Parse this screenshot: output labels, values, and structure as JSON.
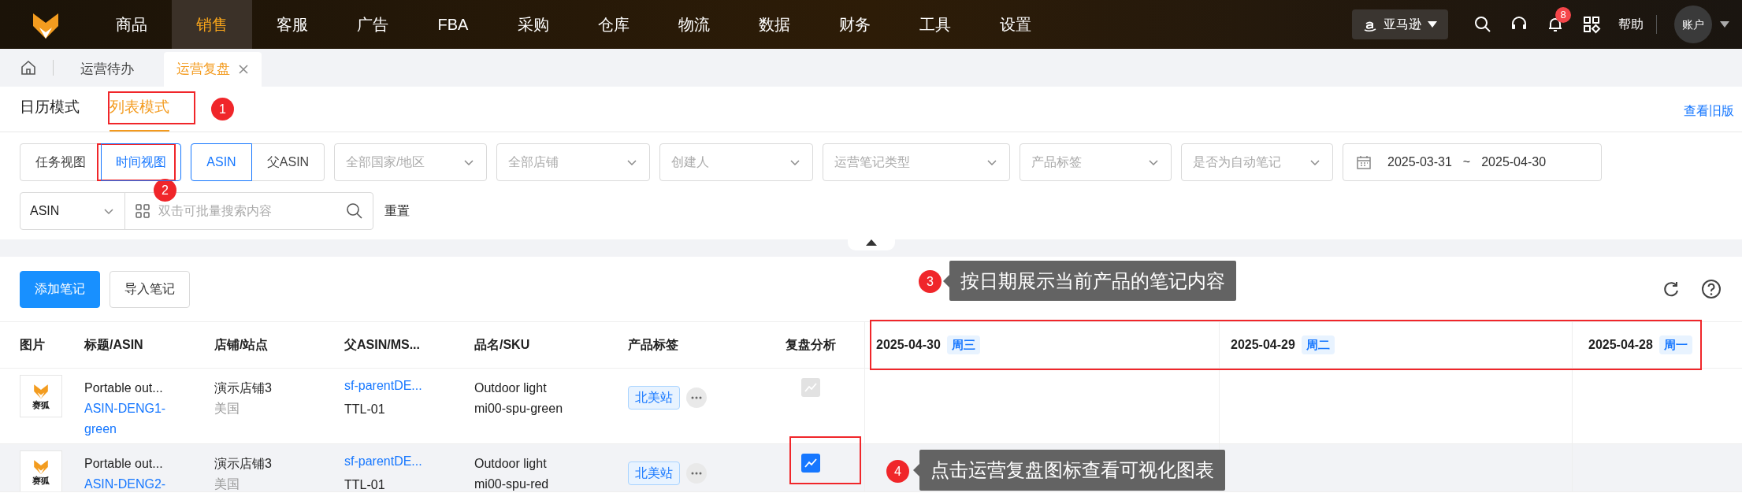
{
  "nav": {
    "items": [
      {
        "label": "商品",
        "selected": false
      },
      {
        "label": "销售",
        "selected": true
      },
      {
        "label": "客服",
        "selected": false
      },
      {
        "label": "广告",
        "selected": false
      },
      {
        "label": "FBA",
        "selected": false
      },
      {
        "label": "采购",
        "selected": false
      },
      {
        "label": "仓库",
        "selected": false
      },
      {
        "label": "物流",
        "selected": false
      },
      {
        "label": "数据",
        "selected": false
      },
      {
        "label": "财务",
        "selected": false
      },
      {
        "label": "工具",
        "selected": false
      },
      {
        "label": "设置",
        "selected": false
      }
    ],
    "platform": "亚马逊",
    "notification_count": "8",
    "help": "帮助",
    "account": "账户"
  },
  "page_tabs": [
    {
      "label": "运营待办",
      "selected": false,
      "closable": false
    },
    {
      "label": "运营复盘",
      "selected": true,
      "closable": true
    }
  ],
  "mode_tabs": [
    {
      "label": "日历模式",
      "selected": false
    },
    {
      "label": "列表模式",
      "selected": true
    }
  ],
  "old_version_link": "查看旧版",
  "view_toggle": [
    {
      "label": "任务视图",
      "selected": false
    },
    {
      "label": "时间视图",
      "selected": true
    }
  ],
  "asin_toggle": [
    {
      "label": "ASIN",
      "selected": true
    },
    {
      "label": "父ASIN",
      "selected": false
    }
  ],
  "filters": [
    {
      "placeholder": "全部国家/地区"
    },
    {
      "placeholder": "全部店铺"
    },
    {
      "placeholder": "创建人"
    },
    {
      "placeholder": "运营笔记类型"
    },
    {
      "placeholder": "产品标签"
    },
    {
      "placeholder": "是否为自动笔记"
    }
  ],
  "date_range": {
    "start": "2025-03-31",
    "separator": "~",
    "end": "2025-04-30"
  },
  "search": {
    "field": "ASIN",
    "placeholder": "双击可批量搜索内容"
  },
  "reset": "重置",
  "actions": [
    {
      "label": "添加笔记",
      "kind": "primary"
    },
    {
      "label": "导入笔记",
      "kind": "default"
    }
  ],
  "table": {
    "columns": [
      "图片",
      "标题/ASIN",
      "店铺/站点",
      "父ASIN/MS...",
      "品名/SKU",
      "产品标签",
      "复盘分析"
    ],
    "date_columns": [
      {
        "date": "2025-04-30",
        "weekday": "周三"
      },
      {
        "date": "2025-04-29",
        "weekday": "周二"
      },
      {
        "date": "2025-04-28",
        "weekday": "周一"
      }
    ],
    "rows": [
      {
        "selected": false,
        "thumbnail_text": "赛狐",
        "title": "Portable out...",
        "asin": "ASIN-DENG1-green",
        "shop": "演示店铺3",
        "site": "美国",
        "parent_asin": "sf-parentDE...",
        "msku": "TTL-01",
        "product_name": "Outdoor light",
        "sku": "mi00-spu-green",
        "tag": "北美站",
        "review_enabled": false
      },
      {
        "selected": true,
        "thumbnail_text": "赛狐",
        "title": "Portable out...",
        "asin": "ASIN-DENG2-",
        "shop": "演示店铺3",
        "site": "美国",
        "parent_asin": "sf-parentDE...",
        "msku": "TTL-01",
        "product_name": "Outdoor light",
        "sku": "mi00-spu-red",
        "tag": "北美站",
        "review_enabled": true
      }
    ]
  },
  "annotations": [
    {
      "number": "1"
    },
    {
      "number": "2"
    },
    {
      "number": "3",
      "tooltip": "按日期展示当前产品的笔记内容"
    },
    {
      "number": "4",
      "tooltip": "点击运营复盘图标查看可视化图表"
    }
  ]
}
